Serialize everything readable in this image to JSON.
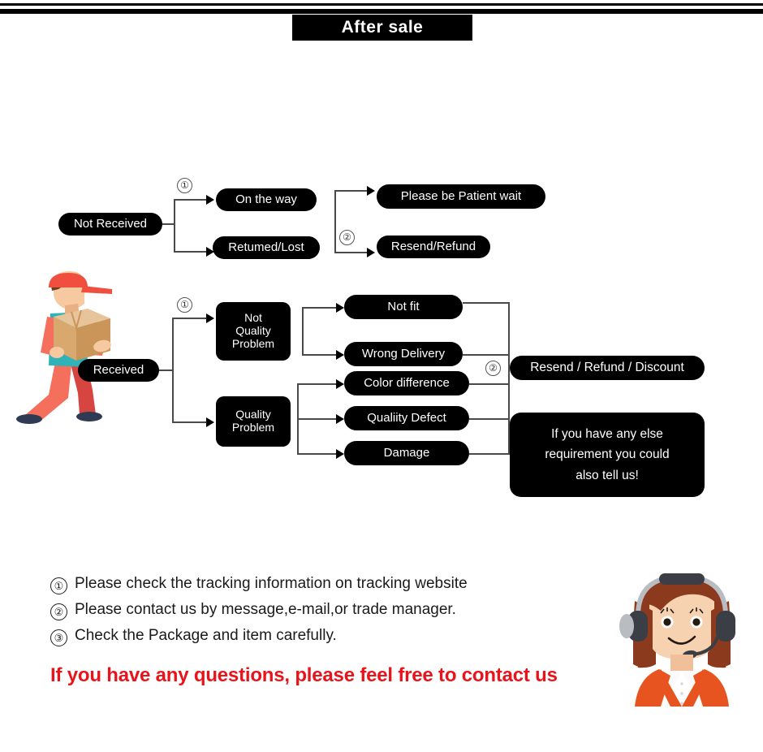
{
  "header": {
    "title": "After sale"
  },
  "flow_not_received": {
    "root": "Not Received",
    "step_marker_1": "①",
    "step_marker_2": "②",
    "branches": [
      "On the way",
      "Retumed/Lost"
    ],
    "outcomes": [
      "Please be Patient wait",
      "Resend/Refund"
    ]
  },
  "flow_received": {
    "root": "Received",
    "step_marker_1": "①",
    "step_marker_2": "②",
    "categories": [
      "Not Quality Problem",
      "Quality Problem"
    ],
    "category_lines": [
      [
        "Not",
        "Quality",
        "Problem"
      ],
      [
        "Quality",
        "Problem"
      ]
    ],
    "issues_not_quality": [
      "Not fit",
      "Wrong Delivery"
    ],
    "issues_quality": [
      "Color difference",
      "Qualiity Defect",
      "Damage"
    ],
    "resolution": "Resend / Refund / Discount",
    "bubble_lines": [
      "If you have any else",
      "requirement you could",
      "also tell us!"
    ]
  },
  "notes": {
    "items": [
      {
        "num": "①",
        "text": "Please check the tracking information on tracking website"
      },
      {
        "num": "②",
        "text": "Please contact us by message,e-mail,or trade manager."
      },
      {
        "num": "③",
        "text": "Check the Package and item carefully."
      }
    ],
    "cta": "If you have any questions, please feel free to contact us"
  },
  "colors": {
    "ink": "#000000",
    "paper": "#ffffff",
    "line": "#4a4a4a",
    "cta_red": "#e8141b",
    "cap_red": "#f04e3e",
    "shirt_teal": "#2fb3b8",
    "sleeve_coral": "#f4705c",
    "pants_coral": "#f4705c",
    "pants_dark": "#d6453f",
    "skin": "#f7c9a0",
    "box_tan": "#deb887",
    "hair_brown": "#8b3a1e",
    "blazer_orange": "#e8541f"
  },
  "illustrations": {
    "delivery_man": "delivery-man-carrying-box",
    "support_agent": "customer-support-agent-headset"
  }
}
